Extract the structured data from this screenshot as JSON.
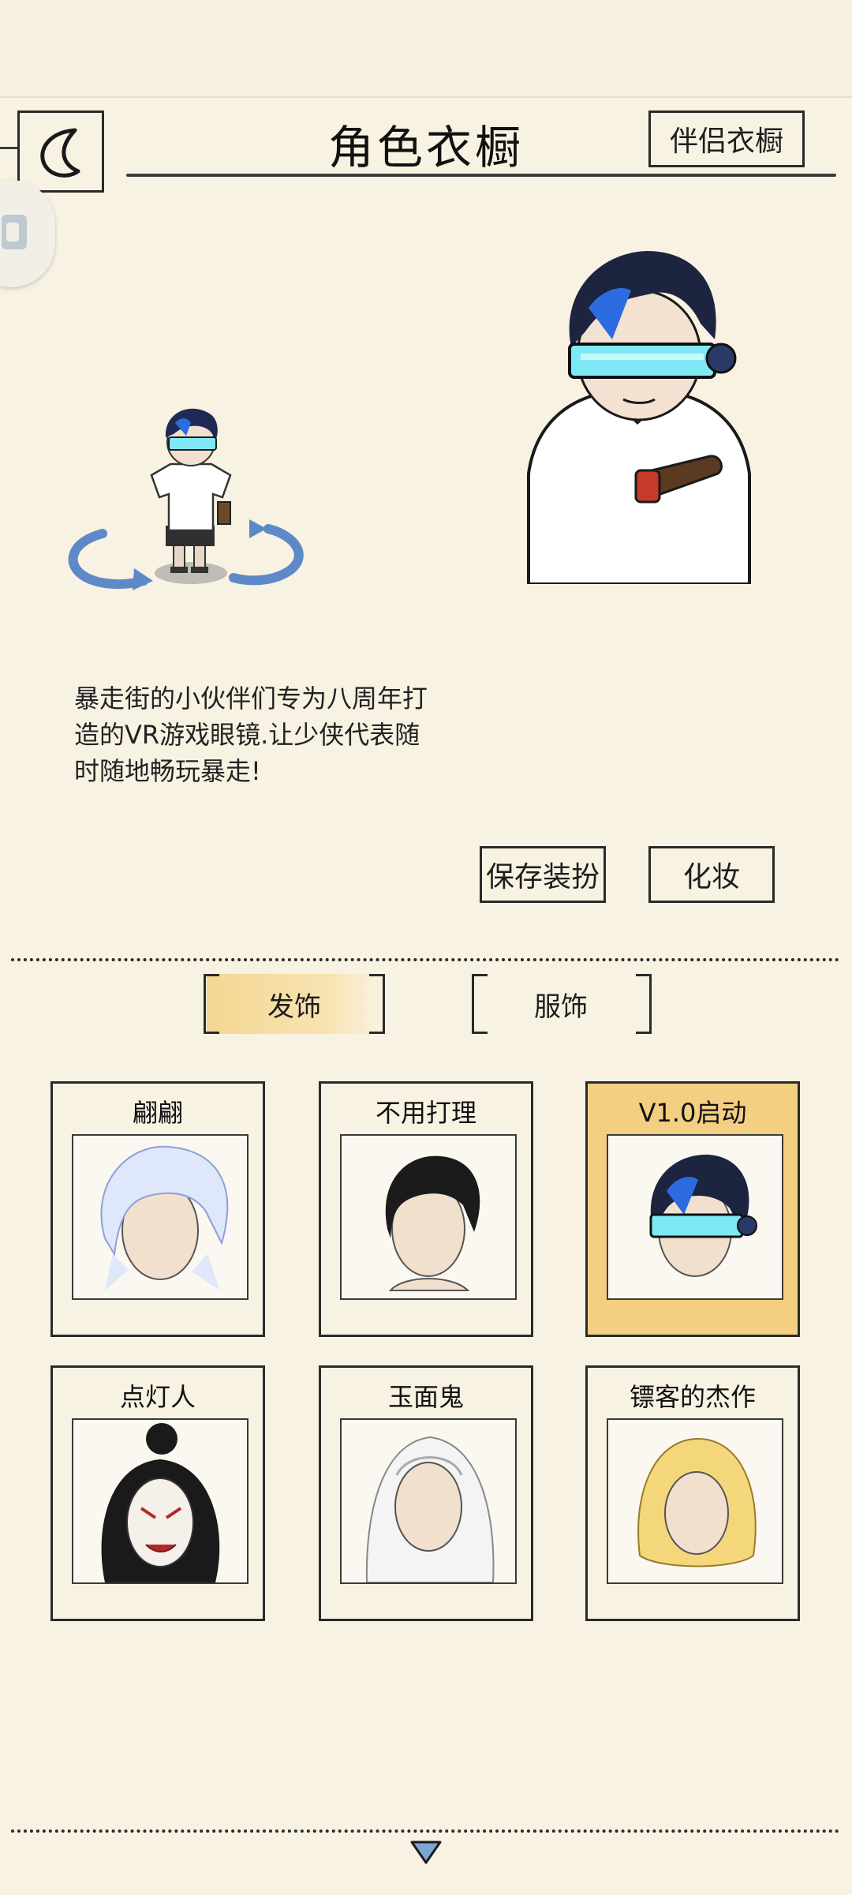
{
  "header": {
    "title": "角色衣橱",
    "partner_wardrobe_label": "伴侣衣橱"
  },
  "description": "暴走街的小伙伴们专为八周年打造的VR游戏眼镜.让少侠代表随时随地畅玩暴走!",
  "actions": {
    "save_label": "保存装扮",
    "makeup_label": "化妆"
  },
  "tabs": [
    {
      "label": "发饰",
      "active": true
    },
    {
      "label": "服饰",
      "active": false
    }
  ],
  "items": [
    {
      "name": "翩翩",
      "selected": false,
      "icon": "hair-white-curly"
    },
    {
      "name": "不用打理",
      "selected": false,
      "icon": "hair-black-messy"
    },
    {
      "name": "V1.0启动",
      "selected": true,
      "icon": "hair-blue-vr-goggles"
    },
    {
      "name": "点灯人",
      "selected": false,
      "icon": "hair-black-bun-mask"
    },
    {
      "name": "玉面鬼",
      "selected": false,
      "icon": "hair-white-long"
    },
    {
      "name": "镖客的杰作",
      "selected": false,
      "icon": "yellow-hood"
    }
  ],
  "colors": {
    "background": "#f8f2e2",
    "selected_card": "#f3cf82",
    "active_tab": "#f3d692",
    "border": "#2a2a2a"
  }
}
